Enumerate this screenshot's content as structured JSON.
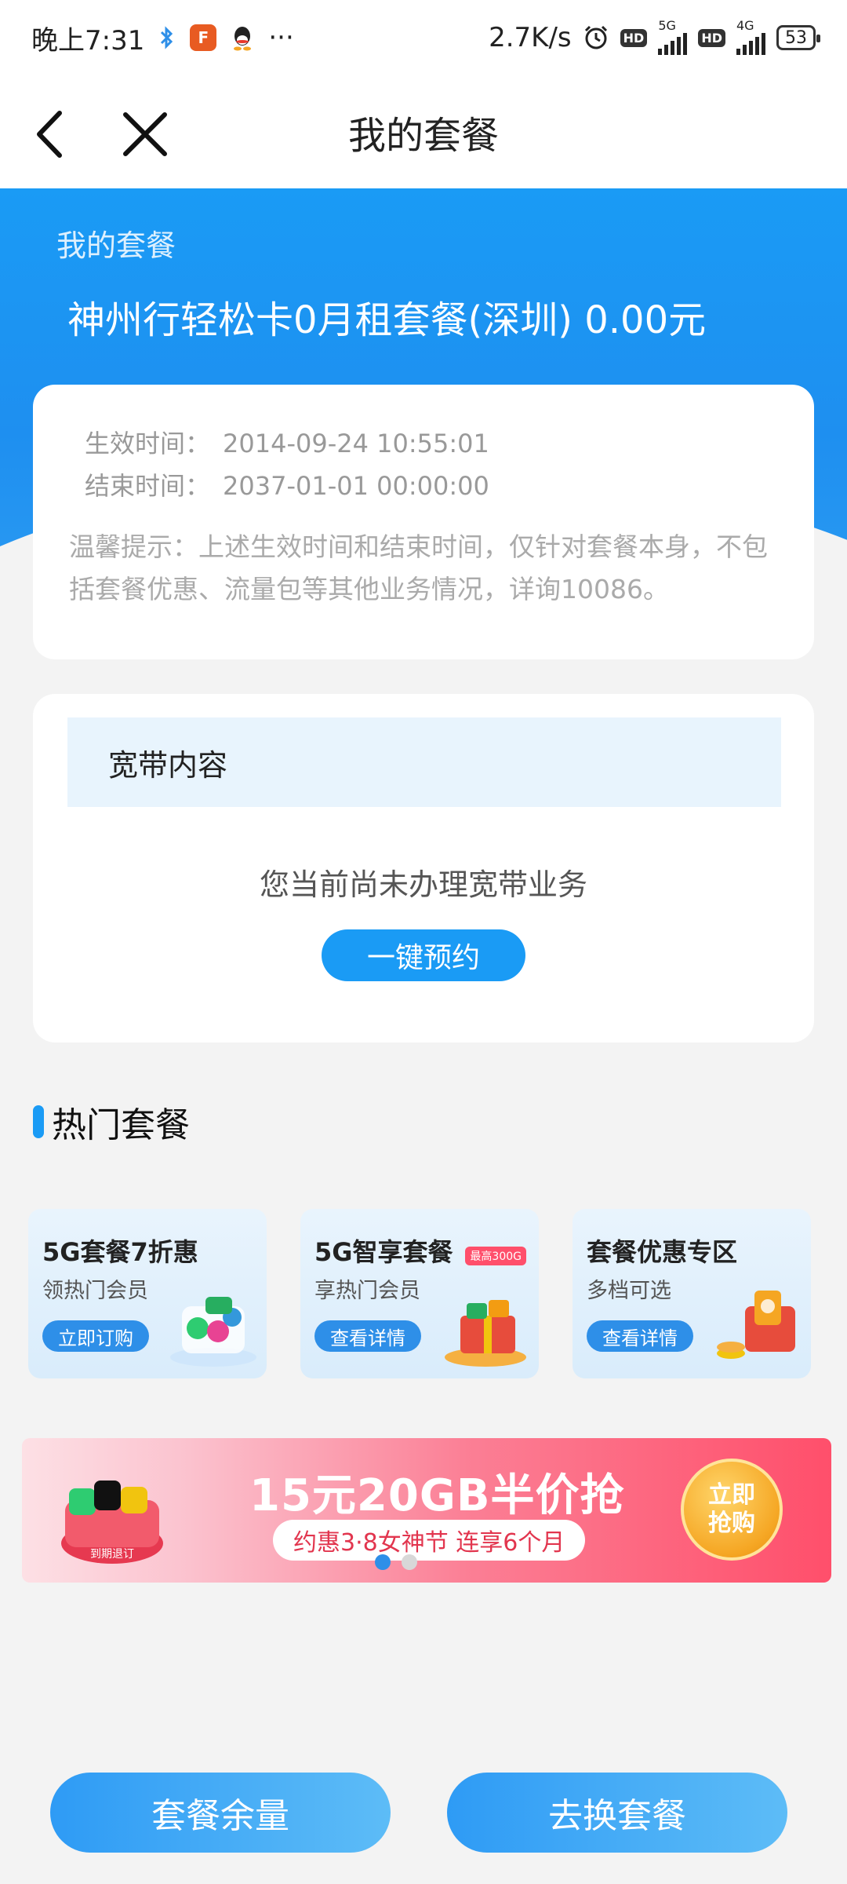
{
  "status_bar": {
    "time": "晚上7:31",
    "more": "···",
    "speed": "2.7K/s",
    "net1": "5G",
    "net2": "4G",
    "hd": "HD",
    "battery": "53"
  },
  "nav": {
    "title": "我的套餐"
  },
  "header": {
    "label": "我的套餐",
    "package_name": "神州行轻松卡0月租套餐(深圳) 0.00元"
  },
  "info": {
    "start_label": "生效时间：",
    "start_value": "2014-09-24 10:55:01",
    "end_label": "结束时间：",
    "end_value": "2037-01-01 00:00:00",
    "tip": "温馨提示：上述生效时间和结束时间，仅针对套餐本身，不包括套餐优惠、流量包等其他业务情况，详询10086。"
  },
  "broadband": {
    "title": "宽带内容",
    "empty_text": "您当前尚未办理宽带业务",
    "button": "一键预约"
  },
  "hot": {
    "title": "热门套餐",
    "items": [
      {
        "title": "5G套餐7折惠",
        "subtitle": "领热门会员",
        "button": "立即订购"
      },
      {
        "title": "5G智享套餐",
        "subtitle": "享热门会员",
        "button": "查看详情",
        "tag": "最高300G"
      },
      {
        "title": "套餐优惠专区",
        "subtitle": "多档可选",
        "button": "查看详情"
      }
    ]
  },
  "banner": {
    "headline": "15元20GB半价抢",
    "sub": "约惠3·8女神节 连享6个月",
    "cta": "立即抢购",
    "gift_text": "到期退订"
  },
  "bottom": {
    "left": "套餐余量",
    "right": "去换套餐"
  },
  "colors": {
    "primary": "#1a9bf5",
    "banner": "#ff4f6b"
  }
}
